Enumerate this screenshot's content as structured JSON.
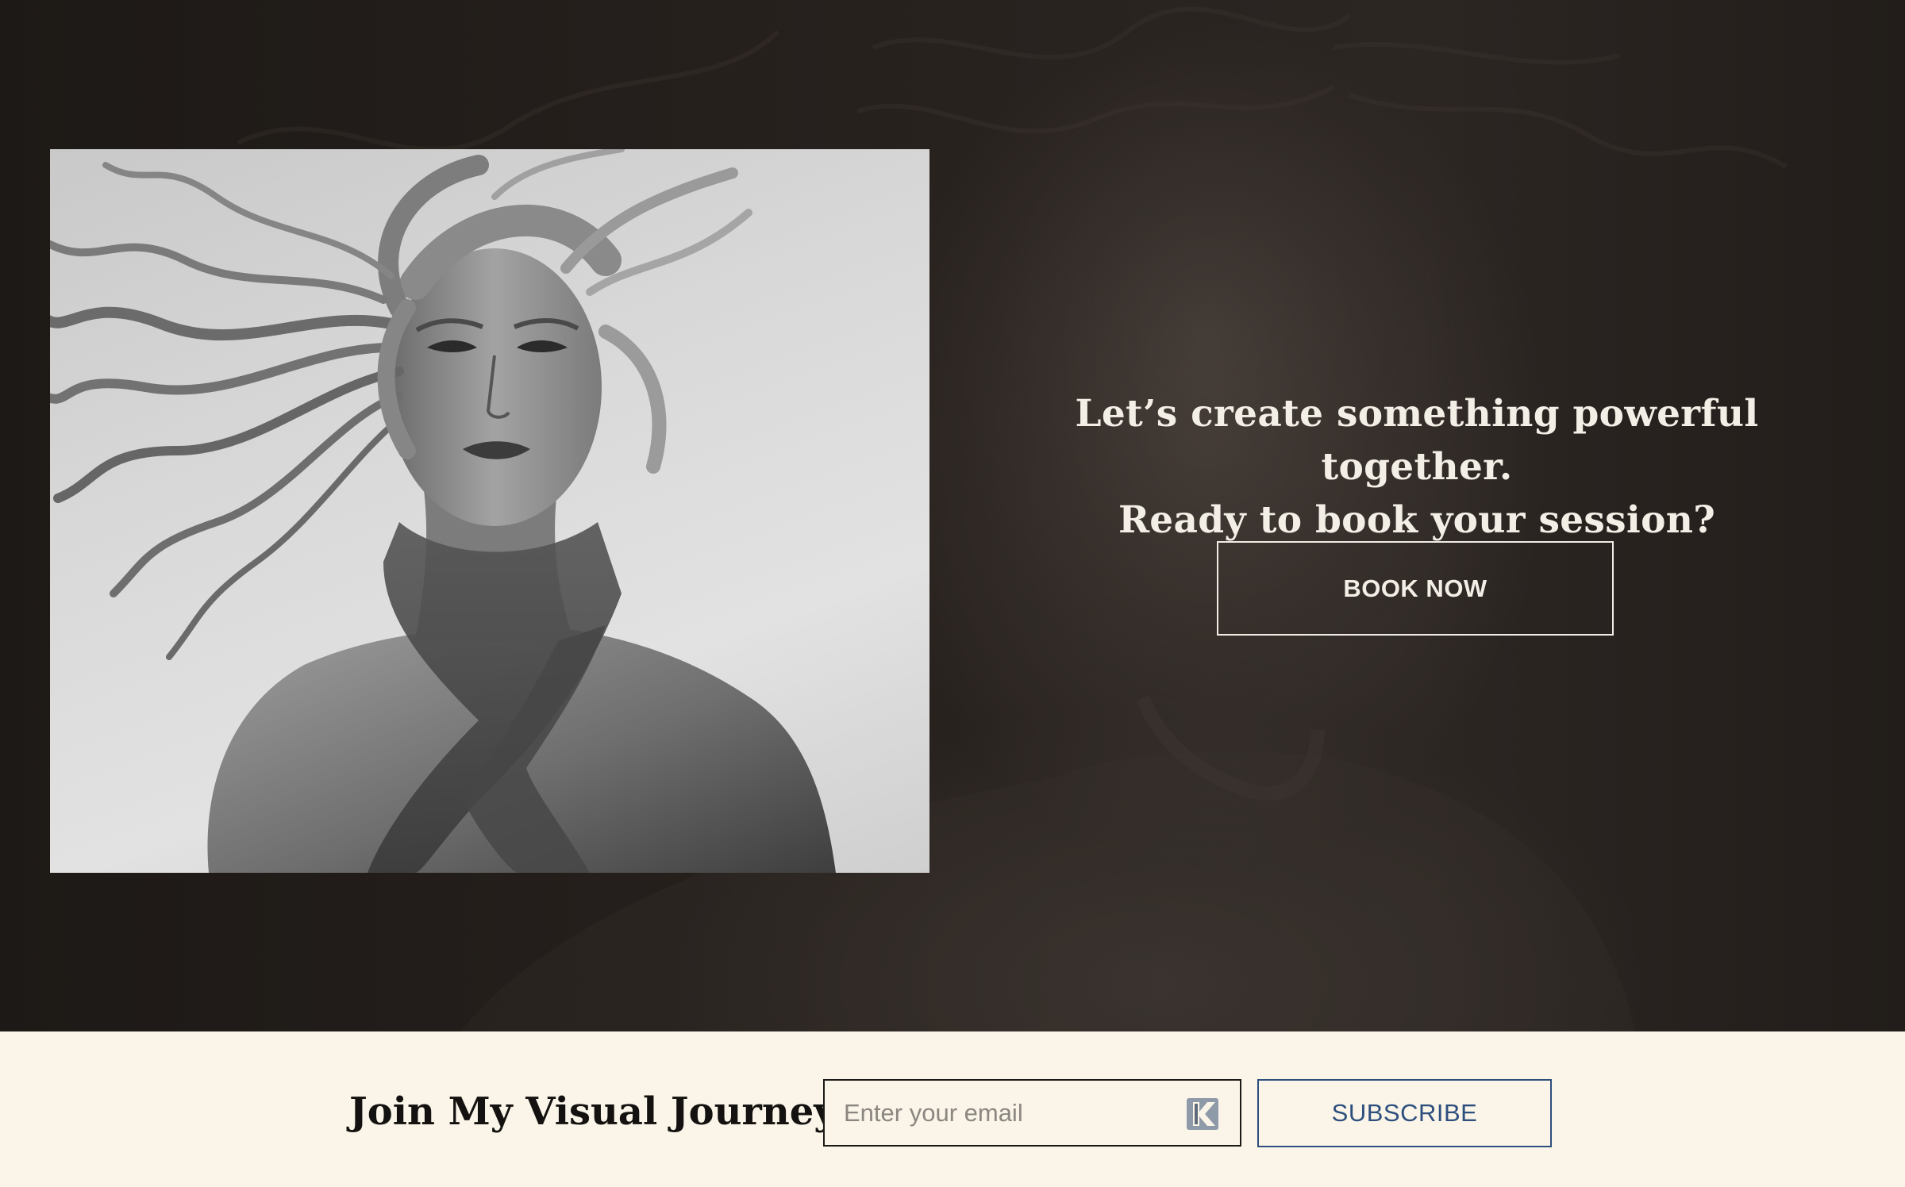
{
  "hero": {
    "headline_line1": "Let’s create something powerful together.",
    "headline_line2": "Ready to book your session?",
    "book_button_label": "BOOK NOW",
    "photo_alt": "Black and white portrait of a woman with windswept hair"
  },
  "newsletter": {
    "title": "Join My Visual Journey",
    "email_placeholder": "Enter your email",
    "email_value": "",
    "autofill_icon": "password-manager-icon",
    "subscribe_label": "SUBSCRIBE"
  },
  "colors": {
    "hero_background": "#231e1b",
    "hero_text": "#f4efe6",
    "newsletter_background": "#faf5e8",
    "newsletter_title": "#141210",
    "subscribe_accent": "#2e4f7e"
  }
}
